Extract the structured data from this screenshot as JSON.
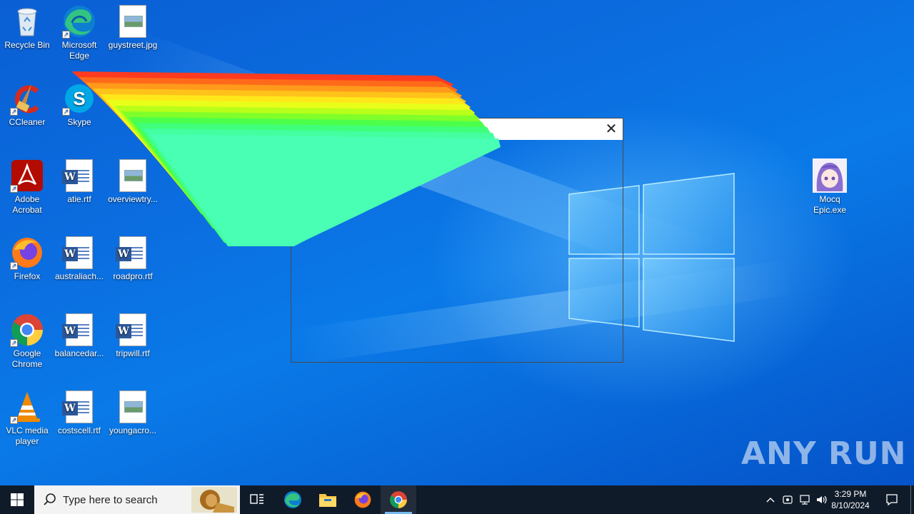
{
  "desktop": {
    "icons": [
      {
        "label": "Recycle Bin",
        "icon": "recycle-bin-icon"
      },
      {
        "label": "Microsoft Edge",
        "icon": "edge-icon"
      },
      {
        "label": "guystreet.jpg",
        "icon": "image-file-icon"
      },
      {
        "label": "CCleaner",
        "icon": "ccleaner-icon"
      },
      {
        "label": "Skype",
        "icon": "skype-icon"
      },
      {
        "label": "Adobe Acrobat",
        "icon": "acrobat-icon"
      },
      {
        "label": "atie.rtf",
        "icon": "word-doc-icon"
      },
      {
        "label": "overviewtry...",
        "icon": "image-file-icon"
      },
      {
        "label": "Firefox",
        "icon": "firefox-icon"
      },
      {
        "label": "australiach...",
        "icon": "word-doc-icon"
      },
      {
        "label": "roadpro.rtf",
        "icon": "word-doc-icon"
      },
      {
        "label": "Google Chrome",
        "icon": "chrome-icon"
      },
      {
        "label": "balancedar...",
        "icon": "word-doc-icon"
      },
      {
        "label": "tripwill.rtf",
        "icon": "word-doc-icon"
      },
      {
        "label": "VLC media player",
        "icon": "vlc-icon"
      },
      {
        "label": "costscell.rtf",
        "icon": "word-doc-icon"
      },
      {
        "label": "youngacro...",
        "icon": "image-file-icon"
      },
      {
        "label": "Mocq Epic.exe",
        "icon": "anime-app-icon"
      }
    ]
  },
  "dialog": {
    "title": "",
    "close_icon": "close-icon"
  },
  "watermark": {
    "text": "ANY RUN"
  },
  "taskbar": {
    "search_placeholder": "Type here to search",
    "pinned": [
      {
        "name": "task-view",
        "icon": "task-view-icon"
      },
      {
        "name": "edge",
        "icon": "edge-icon"
      },
      {
        "name": "file-explorer",
        "icon": "folder-icon"
      },
      {
        "name": "firefox",
        "icon": "firefox-icon"
      },
      {
        "name": "chrome",
        "icon": "chrome-icon",
        "active": true
      }
    ],
    "clock": {
      "time": "3:29 PM",
      "date": "8/10/2024"
    }
  },
  "colors": {
    "taskbar_bg": "#101b2a",
    "wallpaper": "#0a6ee0",
    "active_indicator": "#76b9ed"
  }
}
